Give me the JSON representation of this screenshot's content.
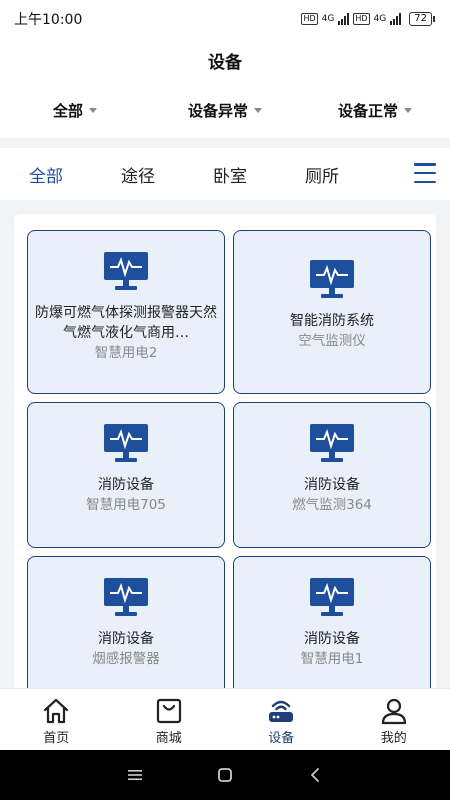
{
  "status_bar": {
    "time": "上午10:00",
    "battery": "72",
    "network": "4G"
  },
  "header": {
    "title": "设备"
  },
  "filters": [
    {
      "label": "全部"
    },
    {
      "label": "设备异常"
    },
    {
      "label": "设备正常"
    }
  ],
  "tabs": [
    {
      "label": "全部",
      "active": true
    },
    {
      "label": "途径",
      "active": false
    },
    {
      "label": "卧室",
      "active": false
    },
    {
      "label": "厕所",
      "active": false
    }
  ],
  "devices": [
    {
      "name": "防爆可燃气体探测报警器天然气燃气液化气商用…",
      "type": "智慧用电2"
    },
    {
      "name": "智能消防系统",
      "type": "空气监测仪"
    },
    {
      "name": "消防设备",
      "type": "智慧用电705"
    },
    {
      "name": "消防设备",
      "type": "燃气监测364"
    },
    {
      "name": "消防设备",
      "type": "烟感报警器"
    },
    {
      "name": "消防设备",
      "type": "智慧用电1"
    }
  ],
  "bottom_nav": [
    {
      "label": "首页",
      "icon": "home-icon"
    },
    {
      "label": "商城",
      "icon": "shopping-bag-icon"
    },
    {
      "label": "设备",
      "icon": "router-icon",
      "active": true
    },
    {
      "label": "我的",
      "icon": "user-icon"
    }
  ],
  "colors": {
    "accent": "#1e4f9c",
    "card_bg": "#eaf0fa",
    "card_border": "#1e3f7a"
  }
}
